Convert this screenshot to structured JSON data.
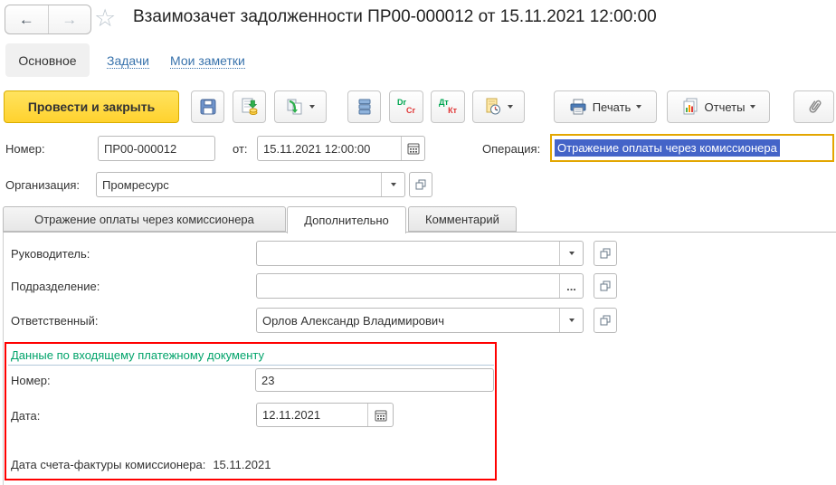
{
  "colors": {
    "accent_yellow": "#FFD633",
    "operation_focus_border": "#E3A600",
    "selection_blue": "#4464C8",
    "group_title_green": "#00A36A",
    "annotation_red": "#FF0000",
    "link_blue": "#3973AC"
  },
  "header": {
    "title": "Взаимозачет задолженности ПР00-000012 от 15.11.2021 12:00:00",
    "back_icon": "←",
    "forward_icon": "→",
    "favorite_icon": "☆"
  },
  "nav": {
    "active": "Основное",
    "links": [
      {
        "label": "Задачи"
      },
      {
        "label": "Мои заметки"
      }
    ]
  },
  "toolbar": {
    "post_and_close": "Провести и закрыть",
    "dr": "Dr",
    "cr": "Cr",
    "dt": "Дт",
    "kt": "Кт",
    "print": "Печать",
    "reports": "Отчеты"
  },
  "document": {
    "number_label": "Номер:",
    "number": "ПР00-000012",
    "date_label": "от:",
    "date": "15.11.2021 12:00:00",
    "operation_label": "Операция:",
    "operation": "Отражение оплаты через комиссионера",
    "organization_label": "Организация:",
    "organization": "Промресурс"
  },
  "tabs": [
    {
      "label": "Отражение оплаты через комиссионера"
    },
    {
      "label": "Дополнительно"
    },
    {
      "label": "Комментарий"
    }
  ],
  "details": {
    "manager_label": "Руководитель:",
    "manager": "",
    "department_label": "Подразделение:",
    "department": "",
    "department_ellipsis": "...",
    "responsible_label": "Ответственный:",
    "responsible": "Орлов Александр Владимирович"
  },
  "payment_doc": {
    "title": "Данные по входящему платежному документу",
    "number_label": "Номер:",
    "number": "23",
    "date_label": "Дата:",
    "date": "12.11.2021",
    "invoice_date_label": "Дата счета-фактуры комиссионера:",
    "invoice_date": "15.11.2021"
  }
}
